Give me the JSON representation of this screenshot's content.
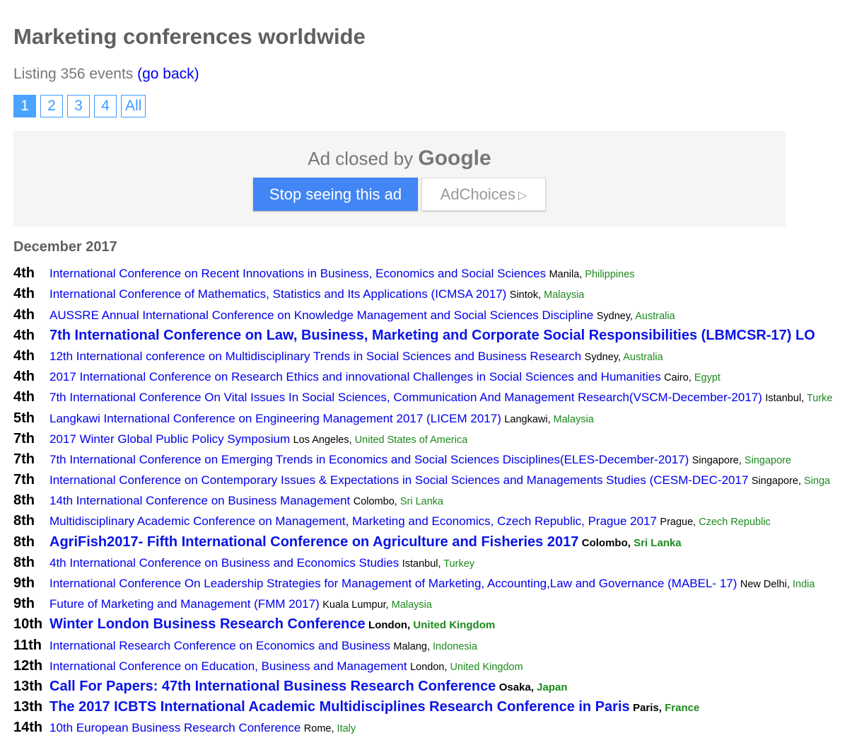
{
  "page": {
    "title": "Marketing conferences worldwide",
    "listing_text": "Listing 356 events ",
    "go_back": "(go back)"
  },
  "pager": {
    "pages": [
      "1",
      "2",
      "3",
      "4",
      "All"
    ],
    "active": "1"
  },
  "ad": {
    "closed_prefix": "Ad closed by ",
    "closed_brand": "Google",
    "stop_label": "Stop seeing this ad",
    "adchoices_label": "AdChoices",
    "colors": {
      "stop_button": "#4285f4",
      "background": "#f5f5f5"
    }
  },
  "month": "December 2017",
  "colors": {
    "link": "#0000ee",
    "country": "#1c8a1c",
    "pager": "#3e9bff"
  },
  "events": [
    {
      "day": "4th",
      "title": "International Conference on Recent Innovations in Business, Economics and Social Sciences",
      "city": "Manila",
      "country": "Philippines",
      "featured": false
    },
    {
      "day": "4th",
      "title": "International Conference of Mathematics, Statistics and Its Applications (ICMSA 2017)",
      "city": "Sintok",
      "country": "Malaysia",
      "featured": false
    },
    {
      "day": "4th",
      "title": "AUSSRE Annual International Conference on Knowledge Management and Social Sciences Discipline",
      "city": "Sydney",
      "country": "Australia",
      "featured": false
    },
    {
      "day": "4th",
      "title": "7th International Conference on Law, Business, Marketing and Corporate Social Responsibilities (LBMCSR-17) LO",
      "city": "",
      "country": "",
      "featured": true
    },
    {
      "day": "4th",
      "title": "12th International conference on Multidisciplinary Trends in Social Sciences and Business Research",
      "city": "Sydney",
      "country": "Australia",
      "featured": false
    },
    {
      "day": "4th",
      "title": "2017 International Conference on Research Ethics and innovational Challenges in Social Sciences and Humanities",
      "city": "Cairo",
      "country": "Egypt",
      "featured": false
    },
    {
      "day": "4th",
      "title": "7th International Conference On Vital Issues In Social Sciences, Communication And Management Research(VSCM-December-2017)",
      "city": "Istanbul",
      "country": "Turke",
      "featured": false
    },
    {
      "day": "5th",
      "title": "Langkawi International Conference on Engineering Management 2017 (LICEM 2017)",
      "city": "Langkawi",
      "country": "Malaysia",
      "featured": false
    },
    {
      "day": "7th",
      "title": "2017 Winter Global Public Policy Symposium",
      "city": "Los Angeles",
      "country": "United States of America",
      "featured": false
    },
    {
      "day": "7th",
      "title": "7th International Conference on Emerging Trends in Economics and Social Sciences Disciplines(ELES-December-2017)",
      "city": "Singapore",
      "country": "Singapore",
      "featured": false
    },
    {
      "day": "7th",
      "title": "International Conference on Contemporary Issues & Expectations in Social Sciences and Managements Studies (CESM-DEC-2017",
      "city": "Singapore",
      "country": "Singa",
      "featured": false
    },
    {
      "day": "8th",
      "title": "14th International Conference on Business Management",
      "city": "Colombo",
      "country": "Sri Lanka",
      "featured": false
    },
    {
      "day": "8th",
      "title": "Multidisciplinary Academic Conference on Management, Marketing and Economics, Czech Republic, Prague 2017",
      "city": "Prague",
      "country": "Czech Republic",
      "featured": false
    },
    {
      "day": "8th",
      "title": "AgriFish2017- Fifth International Conference on Agriculture and Fisheries 2017",
      "city": "Colombo",
      "country": "Sri Lanka",
      "featured": true
    },
    {
      "day": "8th",
      "title": "4th International Conference on Business and Economics Studies",
      "city": "Istanbul",
      "country": "Turkey",
      "featured": false
    },
    {
      "day": "9th",
      "title": "International Conference On Leadership Strategies for Management of Marketing, Accounting,Law and Governance (MABEL- 17)",
      "city": "New Delhi",
      "country": "India",
      "featured": false
    },
    {
      "day": "9th",
      "title": "Future of Marketing and Management (FMM 2017)",
      "city": "Kuala Lumpur",
      "country": "Malaysia",
      "featured": false
    },
    {
      "day": "10th",
      "title": "Winter London Business Research Conference",
      "city": "London",
      "country": "United Kingdom",
      "featured": true
    },
    {
      "day": "11th",
      "title": "International Research Conference on Economics and Business",
      "city": "Malang",
      "country": "Indonesia",
      "featured": false
    },
    {
      "day": "12th",
      "title": "International Conference on Education, Business and Management",
      "city": "London",
      "country": "United Kingdom",
      "featured": false
    },
    {
      "day": "13th",
      "title": "Call For Papers: 47th International Business Research Conference",
      "city": "Osaka",
      "country": "Japan",
      "featured": true
    },
    {
      "day": "13th",
      "title": "The 2017 ICBTS International Academic Multidisciplines Research Conference in Paris",
      "city": "Paris",
      "country": "France",
      "featured": true
    },
    {
      "day": "14th",
      "title": "10th European Business Research Conference",
      "city": "Rome",
      "country": "Italy",
      "featured": false
    }
  ]
}
